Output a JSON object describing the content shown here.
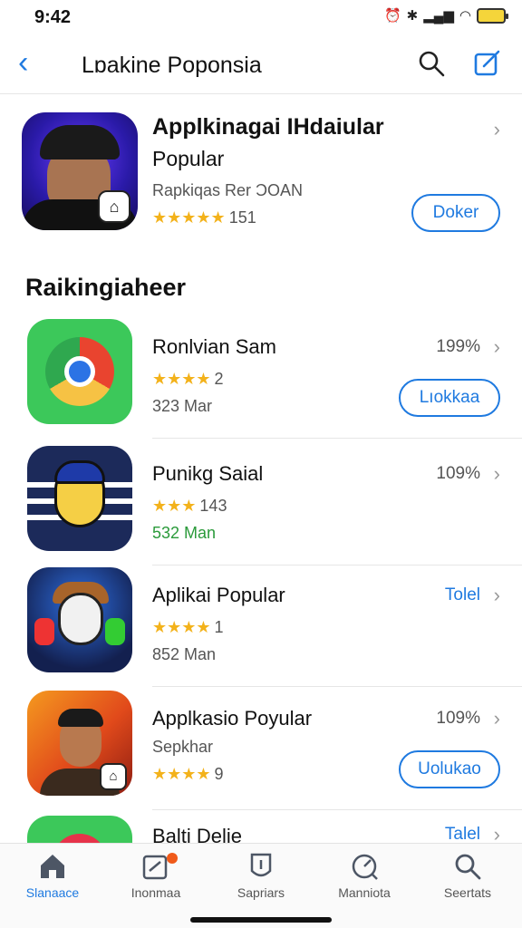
{
  "status_bar": {
    "time": "9:42"
  },
  "nav": {
    "back_label": "‹",
    "title": "Lɒakine Poponsia"
  },
  "featured": {
    "name": "Applkinagai IHdaiular",
    "subtitle": "Popular",
    "meta": "Rapkiqas Rer ƆOAN",
    "stars": "★★★★★",
    "rating_count": "151",
    "button_label": "Doker",
    "chevron": "›"
  },
  "section": {
    "title": "Raikingiaheer"
  },
  "apps": [
    {
      "name": "Ronlvian Sam",
      "stars": "★★★★",
      "rating_count": "2",
      "size": "323 Mar",
      "percent": "199%",
      "button_label": "Lıokkaa",
      "chevron": "›"
    },
    {
      "name": "Punikg Saial",
      "stars": "★★★",
      "rating_count": "143",
      "size": "532 Man",
      "percent": "109%",
      "chevron": "›"
    },
    {
      "name": "Aplikai Popular",
      "stars": "★★★★",
      "rating_count": "1",
      "size": "852 Man",
      "percent": "Tolel",
      "chevron": "›"
    },
    {
      "name": "Applkasio Poyular",
      "subtitle": "Sepkhar",
      "stars": "★★★★",
      "rating_count": "9",
      "percent": "109%",
      "button_label": "Uolukao",
      "chevron": "›"
    },
    {
      "name": "Balti Delie",
      "percent": "Talel",
      "chevron": "›"
    }
  ],
  "tabs": [
    {
      "label": "Slanaace",
      "icon": "home-icon",
      "active": true
    },
    {
      "label": "Inonmaa",
      "icon": "edit-icon"
    },
    {
      "label": "Sapriars",
      "icon": "shield-icon"
    },
    {
      "label": "Manniota",
      "icon": "gauge-icon"
    },
    {
      "label": "Seertats",
      "icon": "search-icon"
    }
  ],
  "colors": {
    "accent": "#1f7ae0",
    "star": "#f3b21b",
    "notification": "#f05a1a"
  }
}
